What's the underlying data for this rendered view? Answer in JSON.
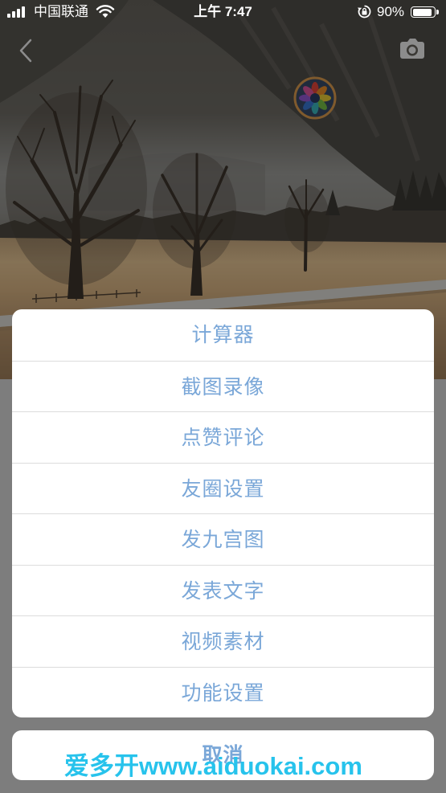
{
  "status_bar": {
    "carrier": "中国联通",
    "time": "上午 7:47",
    "battery_percent": "90%",
    "battery_level": 0.9,
    "icons": [
      "signal-icon",
      "wifi-icon",
      "rotation-lock-icon",
      "battery-icon"
    ]
  },
  "nav": {
    "back_icon": "chevron-left-icon",
    "camera_icon": "camera-icon"
  },
  "profile": {
    "avatar_icon": "flower-logo-icon"
  },
  "action_sheet": {
    "items": [
      {
        "label": "计算器"
      },
      {
        "label": "截图录像"
      },
      {
        "label": "点赞评论"
      },
      {
        "label": "友圈设置"
      },
      {
        "label": "发九宫图"
      },
      {
        "label": "发表文字"
      },
      {
        "label": "视频素材"
      },
      {
        "label": "功能设置"
      }
    ],
    "cancel_label": "取消"
  },
  "watermark": {
    "text": "爱多开www.aiduokai.com"
  },
  "colors": {
    "action_text": "#7aa7d8",
    "watermark": "#27c3ec",
    "sheet_background": "#ffffff",
    "dim_overlay": "rgba(0,0,0,0.45)",
    "avatar_ring": "#e8a552"
  }
}
